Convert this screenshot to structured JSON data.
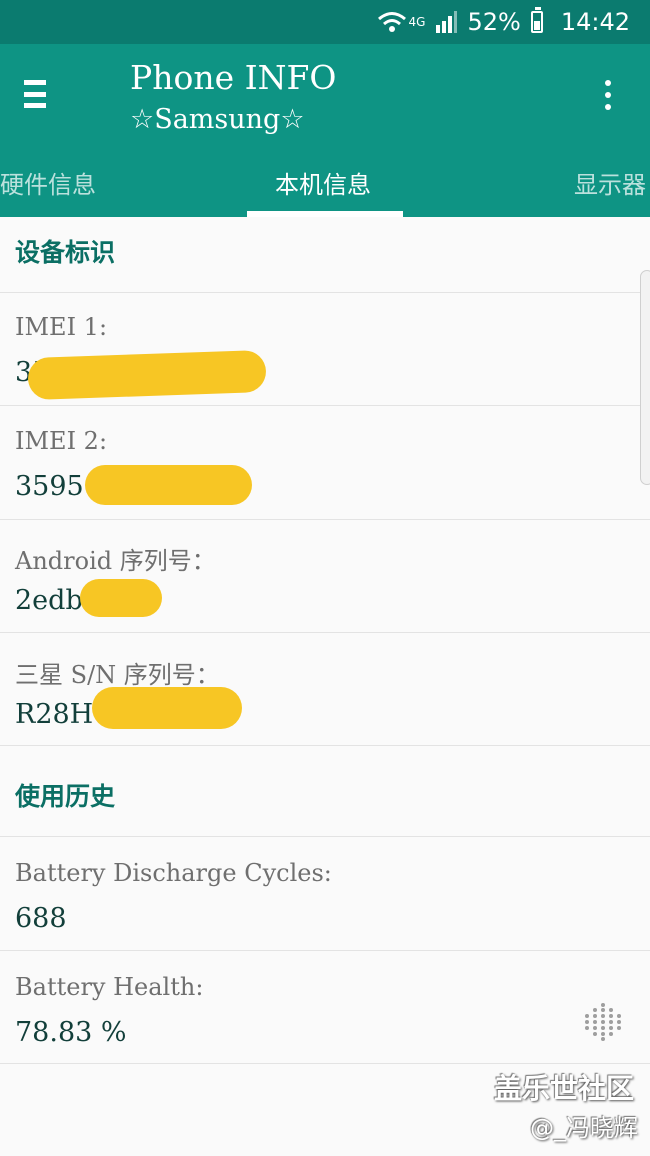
{
  "status_bar": {
    "network": "4G",
    "battery_percent": "52%",
    "time": "14:42",
    "icons": [
      "wifi-icon",
      "signal-icon",
      "battery-icon"
    ]
  },
  "app_bar": {
    "title": "Phone INFO",
    "subtitle": "☆Samsung☆",
    "icons": [
      "menu-icon",
      "more-vert-icon"
    ]
  },
  "tabs": [
    {
      "label": "硬件信息",
      "active": false
    },
    {
      "label": "本机信息",
      "active": true
    },
    {
      "label": "显示器",
      "active": false
    }
  ],
  "sections": [
    {
      "header": "设备标识",
      "rows": [
        {
          "label": "IMEI 1:",
          "value": "35"
        },
        {
          "label": "IMEI 2:",
          "value": "3595"
        },
        {
          "label": "Android 序列号：",
          "value": "2edb"
        },
        {
          "label": "三星 S/N 序列号：",
          "value": "R28H"
        }
      ]
    },
    {
      "header": "使用历史",
      "rows": [
        {
          "label": "Battery Discharge Cycles:",
          "value": "688"
        },
        {
          "label": "Battery Health:",
          "value": "78.83 %"
        }
      ]
    }
  ],
  "watermark": {
    "main": "盖乐世社区",
    "sub": "@_冯晓辉"
  },
  "colors": {
    "status_bar": "#0b7b6f",
    "app_bar": "#0e9484",
    "section_header": "#0b6f64",
    "redaction": "#f7c624"
  }
}
